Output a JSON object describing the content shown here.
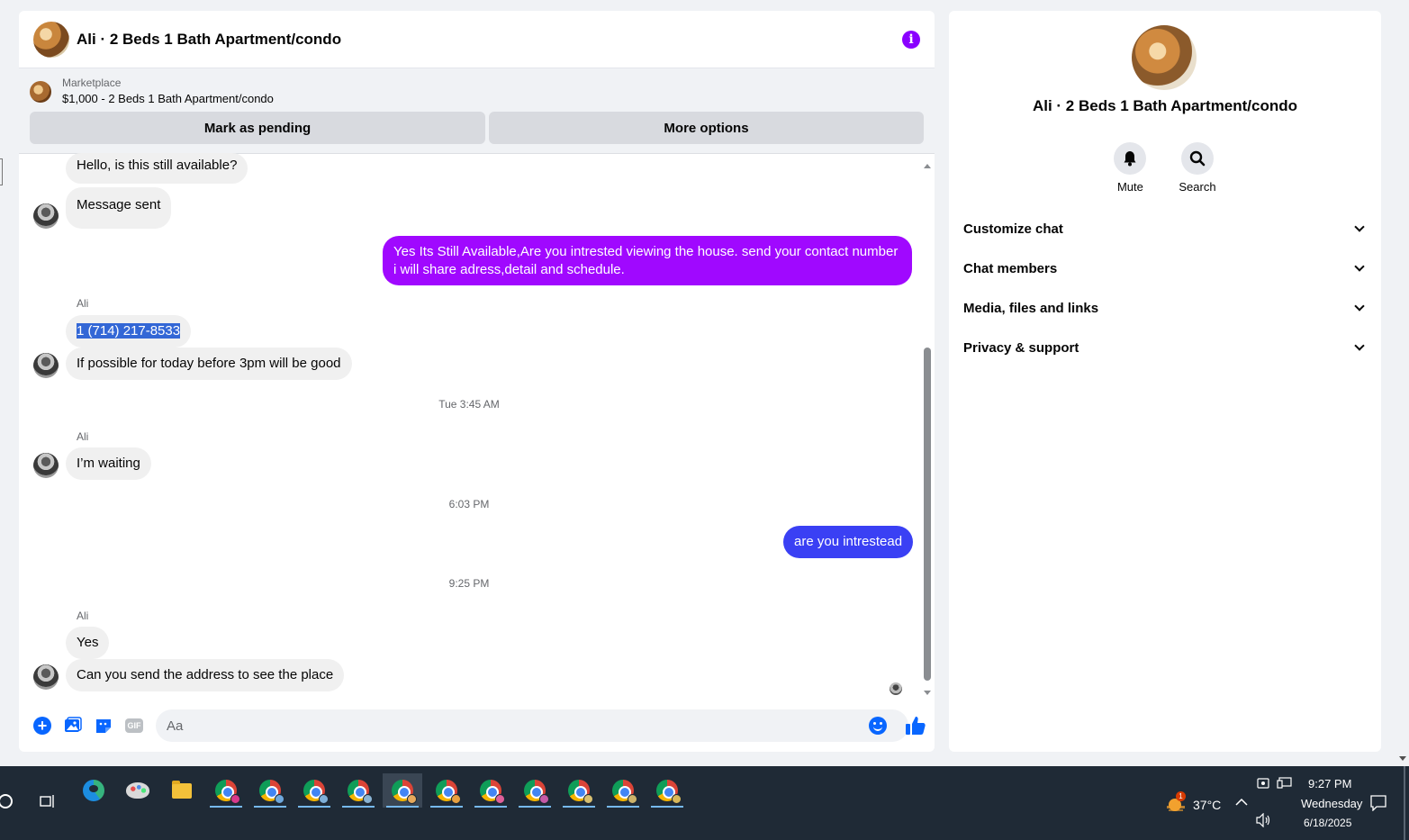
{
  "chat": {
    "title": "Ali · 2 Beds 1 Bath Apartment/condo",
    "marketplace": {
      "label": "Marketplace",
      "listing": "$1,000 - 2 Beds 1 Bath Apartment/condo",
      "mark_pending": "Mark as pending",
      "more_options": "More options"
    },
    "messages": {
      "m1": "Hello, is this still available?",
      "m2": "Message sent",
      "m3": "Yes Its Still Available,Are you intrested viewing the house. send your contact number i will share adress,detail and schedule.",
      "sender1": "Ali",
      "m4": "1 (714) 217-8533",
      "m5": "If possible for today before 3pm will be good",
      "t1": "Tue 3:45 AM",
      "sender2": "Ali",
      "m6": "I’m waiting",
      "t2": "6:03 PM",
      "m7": "are you intrestead",
      "t3": "9:25 PM",
      "sender3": "Ali",
      "m8": "Yes",
      "m9": "Can you send the address to see the place"
    },
    "composer": {
      "placeholder": "Aa",
      "gif_label": "GIF"
    }
  },
  "info": {
    "title": "Ali · 2 Beds 1 Bath Apartment/condo",
    "mute_label": "Mute",
    "search_label": "Search",
    "sections": [
      "Customize chat",
      "Chat members",
      "Media, files and links",
      "Privacy & support"
    ]
  },
  "taskbar": {
    "temperature": "37°C",
    "weather_badge": "1",
    "time": "9:27 PM",
    "day": "Wednesday",
    "date": "6/18/2025"
  },
  "colors": {
    "outgoing_purple": "#a008ff",
    "outgoing_blue": "#3a40f4",
    "accent_blue": "#0866ff",
    "info_purple": "#8a00ff",
    "taskbar_bg": "#1f2a36"
  }
}
